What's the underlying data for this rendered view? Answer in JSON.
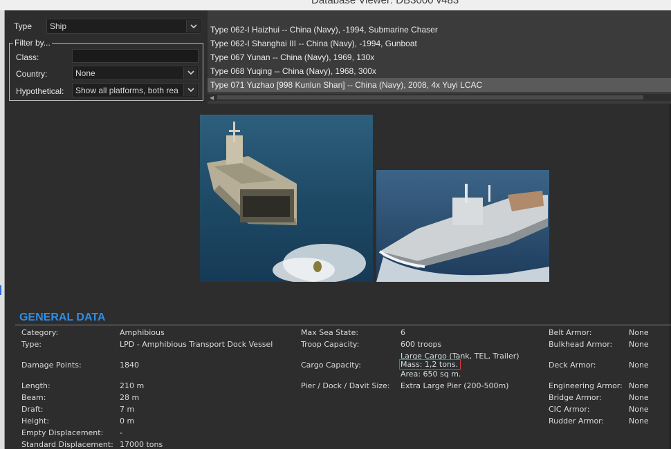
{
  "window": {
    "title": "Database Viewer: DB3000 v483"
  },
  "type_selector": {
    "label": "Type",
    "value": "Ship"
  },
  "filter": {
    "legend": "Filter by...",
    "class_label": "Class:",
    "class_value": "",
    "country_label": "Country:",
    "country_value": "None",
    "hypothetical_label": "Hypothetical:",
    "hypothetical_value": "Show all platforms, both rea"
  },
  "platform_list": [
    {
      "text": "Type 062-I Haizhui -- China (Navy), -1994, Submarine Chaser"
    },
    {
      "text": "Type 062-I Shanghai III -- China (Navy), -1994, Gunboat"
    },
    {
      "text": "Type 067 Yunan -- China (Navy), 1969, 130x"
    },
    {
      "text": "Type 068 Yuqing -- China (Navy), 1968, 300x"
    },
    {
      "text": "Type 071 Yuzhao [998 Kunlun Shan] -- China (Navy), 2008, 4x Yuyi LCAC",
      "selected": true
    }
  ],
  "general": {
    "title": "GENERAL DATA",
    "category_label": "Category:",
    "category": "Amphibious",
    "type_label": "Type:",
    "type": "LPD - Amphibious Transport Dock Vessel",
    "damage_label": "Damage Points:",
    "damage": "1840",
    "length_label": "Length:",
    "length": "210 m",
    "beam_label": "Beam:",
    "beam": "28 m",
    "draft_label": "Draft:",
    "draft": "7 m",
    "height_label": "Height:",
    "height": "0 m",
    "empty_disp_label": "Empty Displacement:",
    "empty_disp": "-",
    "std_disp_label": "Standard Displacement:",
    "std_disp": "17000 tons",
    "sea_state_label": "Max Sea State:",
    "sea_state": "6",
    "troop_label": "Troop Capacity:",
    "troop": "600 troops",
    "cargo_label": "Cargo Capacity:",
    "cargo_line1": "Large Cargo (Tank, TEL, Trailer)",
    "cargo_line2": "Mass: 1,2 tons.",
    "cargo_line3": "Area: 650 sq m.",
    "pier_label": "Pier / Dock / Davit Size:",
    "pier": "Extra Large Pier (200-500m)",
    "belt_label": "Belt Armor:",
    "belt": "None",
    "bulkhead_label": "Bulkhead Armor:",
    "bulkhead": "None",
    "deck_label": "Deck Armor:",
    "deck": "None",
    "engineering_label": "Engineering Armor:",
    "engineering": "None",
    "bridge_label": "Bridge Armor:",
    "bridge": "None",
    "cic_label": "CIC Armor:",
    "cic": "None",
    "rudder_label": "Rudder Armor:",
    "rudder": "None"
  },
  "colors": {
    "accent": "#2f8ee6",
    "highlight_box": "#e23b3b",
    "background": "#2d2d2d"
  }
}
